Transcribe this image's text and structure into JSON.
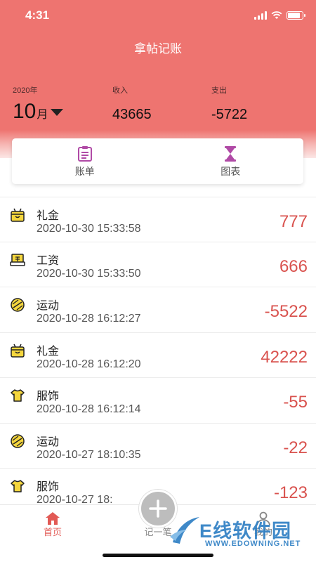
{
  "status": {
    "time": "4:31"
  },
  "app": {
    "title": "拿帖记账"
  },
  "summary": {
    "year_label": "2020年",
    "month_number": "10",
    "month_unit": "月",
    "income_label": "收入",
    "income_value": "43665",
    "expense_label": "支出",
    "expense_value": "-5722"
  },
  "tabs": [
    {
      "label": "账单",
      "icon": "bill-icon"
    },
    {
      "label": "图表",
      "icon": "hourglass-icon"
    }
  ],
  "colors": {
    "header": "#ee7470",
    "accent": "#e25a55",
    "amount": "#d9534f",
    "icon_yellow": "#f5d63d"
  },
  "transactions": [
    {
      "category": "礼金",
      "time": "2020-10-30 15:33:58",
      "amount": "777",
      "icon": "gift-box-icon"
    },
    {
      "category": "工资",
      "time": "2020-10-30 15:33:50",
      "amount": "666",
      "icon": "salary-icon"
    },
    {
      "category": "运动",
      "time": "2020-10-28 16:12:27",
      "amount": "-5522",
      "icon": "ball-icon"
    },
    {
      "category": "礼金",
      "time": "2020-10-28 16:12:20",
      "amount": "42222",
      "icon": "gift-box-icon"
    },
    {
      "category": "服饰",
      "time": "2020-10-28 16:12:14",
      "amount": "-55",
      "icon": "tshirt-icon"
    },
    {
      "category": "运动",
      "time": "2020-10-27 18:10:35",
      "amount": "-22",
      "icon": "ball-icon"
    },
    {
      "category": "服饰",
      "time": "2020-10-27 18:",
      "amount": "-123",
      "icon": "tshirt-icon"
    }
  ],
  "nav": {
    "home_label": "首页",
    "add_label": "记一笔",
    "me_label": "我的"
  },
  "watermark": {
    "brand": "E线软件园",
    "url": "WWW.EDOWNING.NET"
  }
}
